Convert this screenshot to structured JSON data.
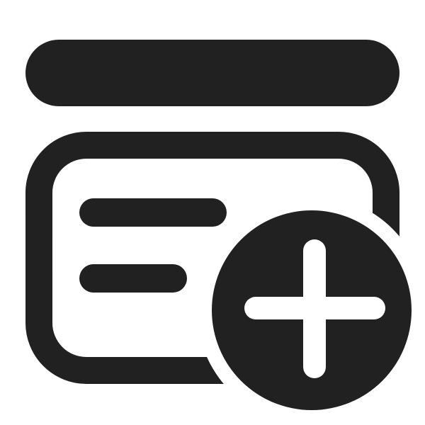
{
  "icon": {
    "name": "add-list-card-icon",
    "color": "#212121",
    "background": "#ffffff"
  }
}
